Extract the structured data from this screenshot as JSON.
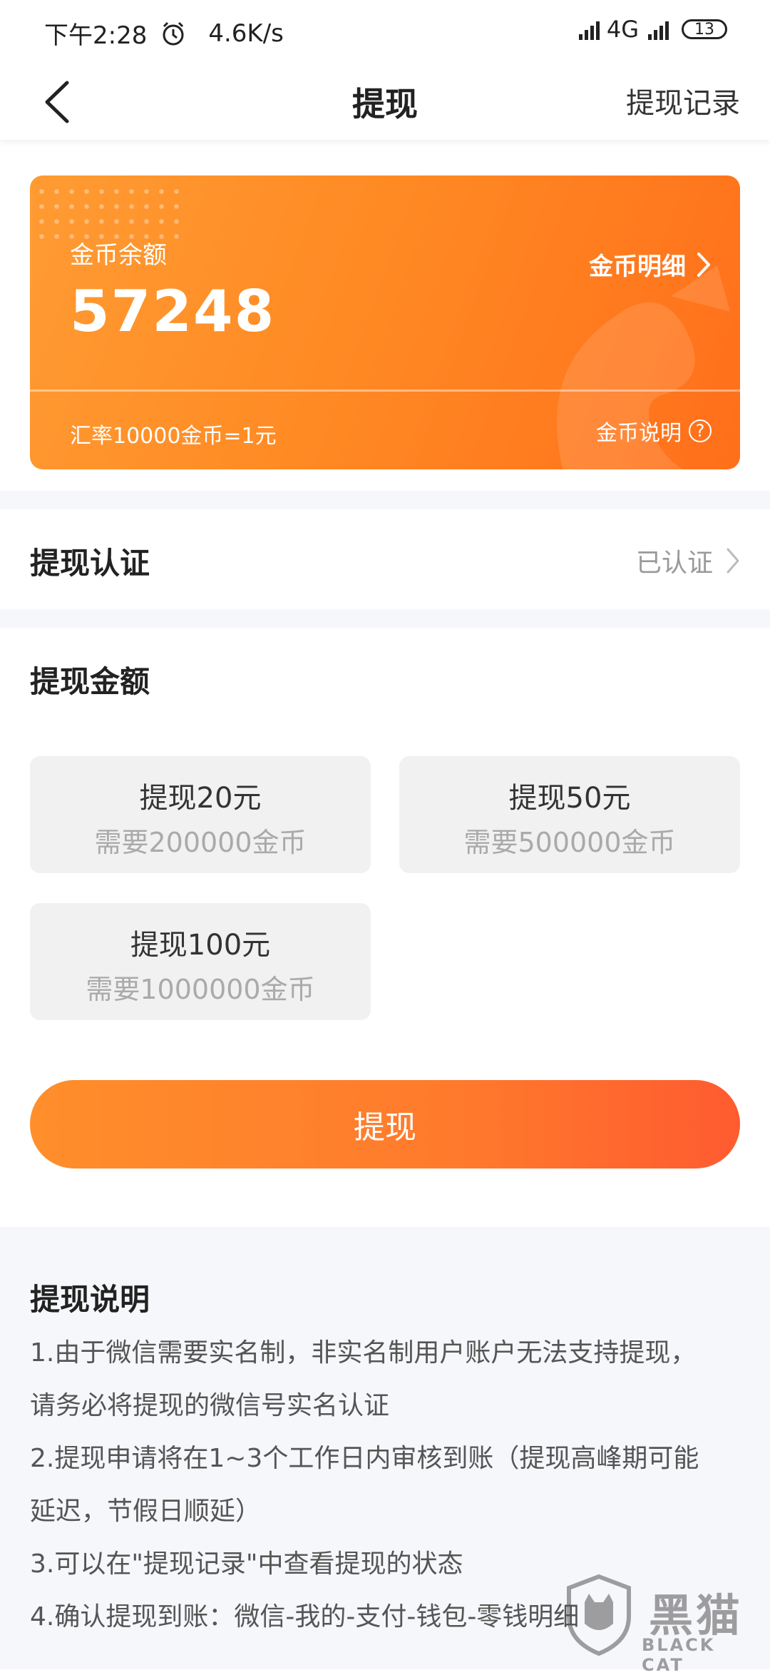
{
  "status_bar": {
    "time": "下午2:28",
    "speed": "4.6K/s",
    "network": "4G",
    "battery": "13"
  },
  "nav": {
    "title": "提现",
    "right_link": "提现记录"
  },
  "coin_card": {
    "label": "金币余额",
    "balance": "57248",
    "detail_link": "金币明细",
    "rate": "汇率10000金币=1元",
    "help_link": "金币说明",
    "help_symbol": "?"
  },
  "auth": {
    "label": "提现认证",
    "status": "已认证"
  },
  "amount": {
    "title": "提现金额",
    "options": [
      {
        "label": "提现20元",
        "requirement": "需要200000金币"
      },
      {
        "label": "提现50元",
        "requirement": "需要500000金币"
      },
      {
        "label": "提现100元",
        "requirement": "需要1000000金币"
      }
    ]
  },
  "submit_label": "提现",
  "notes": {
    "title": "提现说明",
    "lines": [
      "1.由于微信需要实名制，非实名制用户账户无法支持提现，",
      "请务必将提现的微信号实名认证",
      "2.提现申请将在1~3个工作日内审核到账（提现高峰期可能",
      "延迟，节假日顺延）",
      "3.可以在\"提现记录\"中查看提现的状态",
      "4.确认提现到账：微信-我的-支付-钱包-零钱明细"
    ]
  },
  "watermark": {
    "text": "黑猫",
    "sub": "BLACK CAT"
  },
  "colors": {
    "accent": "#ff7a2c",
    "card_start": "#ff9b33",
    "card_end": "#ff6f1a",
    "background_gray": "#f6f7fb"
  }
}
